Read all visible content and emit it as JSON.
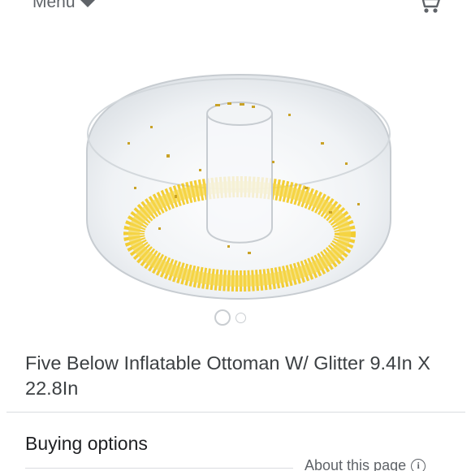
{
  "header": {
    "menu_label": "Menu",
    "menu_icon": "chevron-down-icon",
    "cart_icon": "shopping-cart-icon"
  },
  "product": {
    "image_description": "Inflatable ottoman with glitter",
    "title": "Five Below Inflatable Ottoman W/ Glitter 9.4In X 22.8In",
    "carousel": {
      "total": 2,
      "active_index": 0
    }
  },
  "sections": {
    "buying_options": "Buying options",
    "about_page": "About this page",
    "about_icon": "info-icon"
  },
  "colors": {
    "glitter_gold": "#f2c511",
    "text_primary": "#202124",
    "text_secondary": "#5f6368",
    "divider": "#dadce0"
  }
}
